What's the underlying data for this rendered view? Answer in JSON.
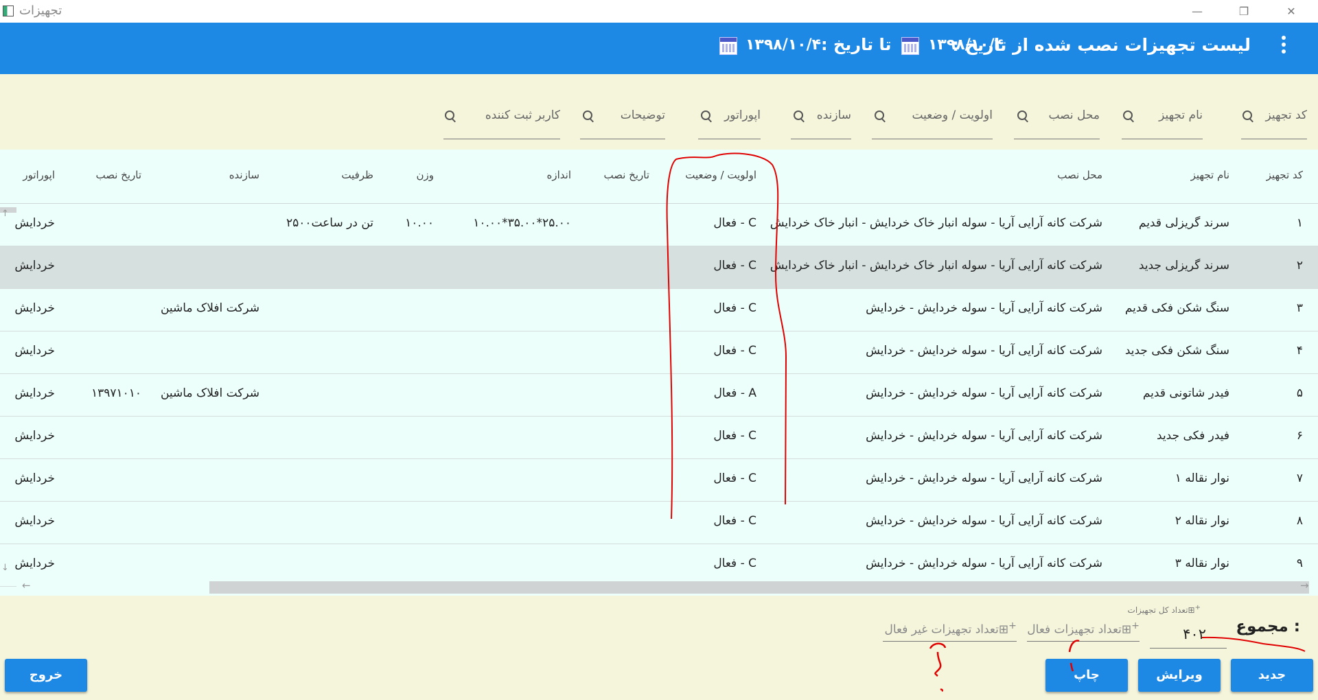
{
  "window": {
    "title": "تجهیزات",
    "min": "—",
    "restore": "❐",
    "close": "✕"
  },
  "header": {
    "title": "لیست تجهیزات نصب شده از تاریخ :",
    "from_date": "۱۳۹۸/۱۰/۴",
    "to_label": "تا تاریخ :",
    "to_date": "۱۳۹۸/۱۰/۴"
  },
  "search": {
    "fields": [
      "کد تجهیز",
      "نام تجهیز",
      "محل نصب",
      "اولویت / وضعیت",
      "سازنده",
      "اپوراتور",
      "توضیحات",
      "کاربر ثبت کننده"
    ]
  },
  "table": {
    "columns": [
      "کد تجهیز",
      "نام تجهیز",
      "محل نصب",
      "اولویت / وضعیت",
      "تاریخ نصب",
      "اندازه",
      "وزن",
      "ظرفیت",
      "سازنده",
      "تاریخ نصب",
      "اپوراتور"
    ],
    "rows": [
      {
        "code": "۱",
        "name": "سرند گریزلی قدیم",
        "location": "شرکت کانه آرایی آریا - سوله انبار خاک خردایش - انبار خاک خردایش",
        "status": "فعال - C",
        "size": "۱۰.۰۰*۳۵.۰۰*۲۵.۰۰",
        "weight": "۱۰.۰۰",
        "capacity": "۲۵۰۰تن در ساعت",
        "maker": "",
        "date2": "",
        "operator": "خردایش"
      },
      {
        "code": "۲",
        "name": "سرند گریزلی جدید",
        "location": "شرکت کانه آرایی آریا - سوله انبار خاک خردایش - انبار خاک خردایش",
        "status": "فعال - C",
        "size": "",
        "weight": "",
        "capacity": "",
        "maker": "",
        "date2": "",
        "operator": "خردایش"
      },
      {
        "code": "۳",
        "name": "سنگ شکن فکی قدیم",
        "location": "شرکت کانه آرایی آریا - سوله خردایش - خردایش",
        "status": "فعال - C",
        "size": "",
        "weight": "",
        "capacity": "",
        "maker": "شرکت افلاک ماشین",
        "date2": "",
        "operator": "خردایش"
      },
      {
        "code": "۴",
        "name": "سنگ شکن فکی جدید",
        "location": "شرکت کانه آرایی آریا - سوله خردایش - خردایش",
        "status": "فعال - C",
        "size": "",
        "weight": "",
        "capacity": "",
        "maker": "",
        "date2": "",
        "operator": "خردایش"
      },
      {
        "code": "۵",
        "name": "فیدر شاتونی قدیم",
        "location": "شرکت کانه آرایی آریا - سوله خردایش - خردایش",
        "status": "فعال - A",
        "size": "",
        "weight": "",
        "capacity": "",
        "maker": "شرکت افلاک ماشین",
        "date2": "۱۳۹۷۱۰۱۰",
        "operator": "خردایش"
      },
      {
        "code": "۶",
        "name": "فیدر فکی جدید",
        "location": "شرکت کانه آرایی آریا - سوله خردایش - خردایش",
        "status": "فعال - C",
        "size": "",
        "weight": "",
        "capacity": "",
        "maker": "",
        "date2": "",
        "operator": "خردایش"
      },
      {
        "code": "۷",
        "name": "نوار نقاله ۱",
        "location": "شرکت کانه آرایی آریا - سوله خردایش - خردایش",
        "status": "فعال - C",
        "size": "",
        "weight": "",
        "capacity": "",
        "maker": "",
        "date2": "",
        "operator": "خردایش"
      },
      {
        "code": "۸",
        "name": "نوار نقاله ۲",
        "location": "شرکت کانه آرایی آریا - سوله خردایش - خردایش",
        "status": "فعال - C",
        "size": "",
        "weight": "",
        "capacity": "",
        "maker": "",
        "date2": "",
        "operator": "خردایش"
      },
      {
        "code": "۹",
        "name": "نوار نقاله ۳",
        "location": "شرکت کانه آرایی آریا - سوله خردایش - خردایش",
        "status": "فعال - C",
        "size": "",
        "weight": "",
        "capacity": "",
        "maker": "",
        "date2": "",
        "operator": "خردایش"
      }
    ]
  },
  "footer": {
    "sum_label": "مجموع :",
    "total_caption": "تعداد کل تجهیزات",
    "total_value": "۴۰۲",
    "active_label": "تعداد تجهیزات فعال",
    "inactive_label": "تعداد تجهیزات غیر فعال"
  },
  "buttons": {
    "new": "جدید",
    "edit": "ویرایش",
    "print": "چاپ",
    "exit": "خروج"
  },
  "colors": {
    "primary": "#1e88e5",
    "band": "#f5f5dc",
    "table_bg": "#ecfffb",
    "selected_row": "#d5e0df",
    "annotation": "#e00000"
  }
}
